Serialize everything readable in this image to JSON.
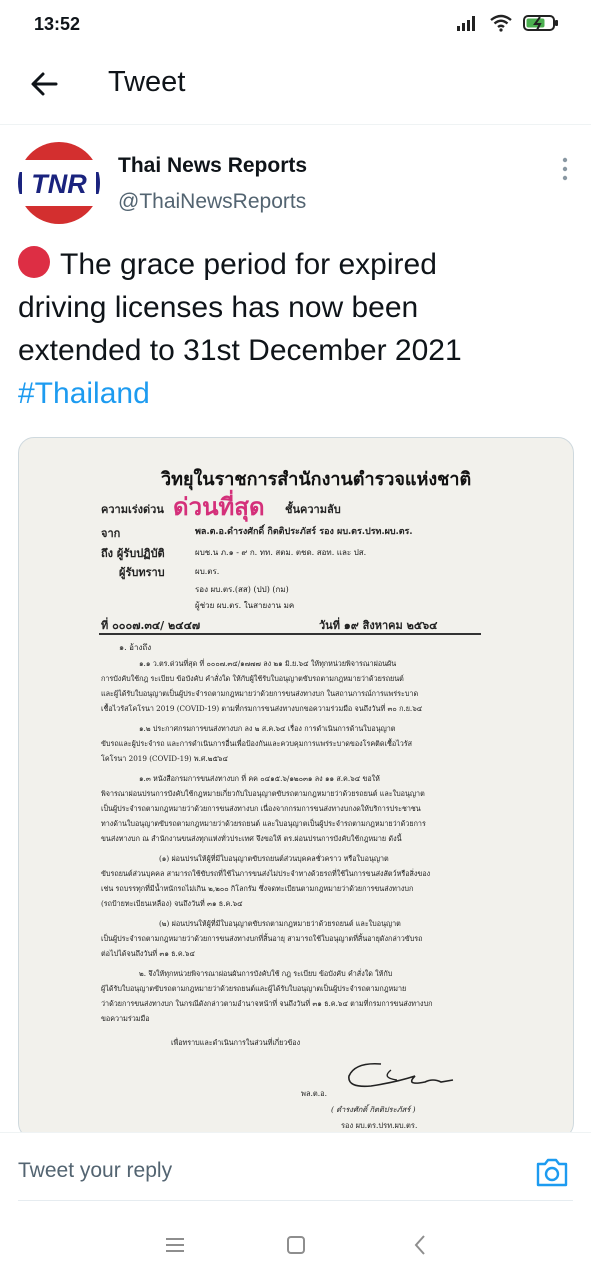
{
  "status": {
    "time": "13:52"
  },
  "appbar": {
    "title": "Tweet"
  },
  "tweet": {
    "author_name": "Thai News Reports",
    "author_handle": "@ThaiNewsReports",
    "avatar_text": "TNR",
    "text_line1": "The grace period for expired",
    "text_line2": "driving licenses has now been",
    "text_line3": "extended to 31st December 2021",
    "hashtag": "#Thailand"
  },
  "document": {
    "heading": "วิทยุในราชการสำนักงานตำรวจแห่งชาติ",
    "urgency_label": "ความเร่งด่วน",
    "urgency_stamp": "ด่วนที่สุด",
    "secrecy_label": "ชั้นความลับ",
    "from_label": "จาก",
    "from_value": "พล.ต.อ.ดำรงศักดิ์ กิตติประภัสร์ รอง ผบ.ตร.ปรท.ผบ.ตร.",
    "to_label": "ถึง ผู้รับปฏิบัติ",
    "to_value": "ผบช.น ภ.๑ - ๙ ก. ทท. สตม. ตชด. สอท. และ ปส.",
    "cc_label": "ผู้รับทราบ",
    "cc_value1": "ผบ.ตร.",
    "cc_value2": "รอง ผบ.ตร.(สส) (ปป) (กม)",
    "cc_value3": "ผู้ช่วย ผบ.ตร. ในสายงาน มค",
    "ref_no": "ที่ ๐๐๐๗.๓๔/ ๒๔๔๗",
    "date_label": "วันที่ ๑๙ สิงหาคม ๒๕๖๔",
    "p_ref": "๑. อ้างถึง",
    "p1_1": "๑.๑ ว.ตร.ด่วนที่สุด ที่ ๐๐๐๗.๓๔/๑๗๗๗ ลง ๒๑ มิ.ย.๖๔ ให้ทุกหน่วยพิจารณาผ่อนผัน",
    "p1_2": "การบังคับใช้กฎ ระเบียบ ข้อบังคับ คำสั่งใด ให้กับผู้ใช้รับใบอนุญาตขับรถตามกฎหมายว่าด้วยรถยนต์",
    "p1_3": "และผู้ได้รับใบอนุญาตเป็นผู้ประจำรถตามกฎหมายว่าด้วยการขนส่งทางบก ในสถานการณ์การแพร่ระบาด",
    "p1_4": "เชื้อไวรัสโคโรนา 2019 (COVID-19) ตามที่กรมการขนส่งทางบกขอความร่วมมือ จนถึงวันที่ ๓๐ ก.ย.๖๔",
    "p2_1": "๑.๒ ประกาศกรมการขนส่งทางบก ลง ๒ ส.ค.๖๔ เรื่อง การดำเนินการด้านใบอนุญาต",
    "p2_2": "ขับรถและผู้ประจำรถ และการดำเนินการอื่นเพื่อป้องกันและควบคุมการแพร่ระบาดของโรคติดเชื้อไวรัส",
    "p2_3": "โคโรนา 2019 (COVID-19) พ.ศ.๒๕๖๔",
    "p3_1": "๑.๓ หนังสือกรมการขนส่งทางบก ที่ คค ๐๔๑๕.๖/๑๒๐๓๑ ลง ๑๑ ส.ค.๖๔ ขอให้",
    "p3_2": "พิจารณาผ่อนปรนการบังคับใช้กฎหมายเกี่ยวกับใบอนุญาตขับรถตามกฎหมายว่าด้วยรถยนต์ และใบอนุญาต",
    "p3_3": "เป็นผู้ประจำรถตามกฎหมายว่าด้วยการขนส่งทางบก เนื่องจากกรมการขนส่งทางบกงดให้บริการประชาชน",
    "p3_4": "ทางด้านใบอนุญาตขับรถตามกฎหมายว่าด้วยรถยนต์ และใบอนุญาตเป็นผู้ประจำรถตามกฎหมายว่าด้วยการ",
    "p3_5": "ขนส่งทางบก ณ สำนักงานขนส่งทุกแห่งทั่วประเทศ จึงขอให้ ตร.ผ่อนปรนการบังคับใช้กฎหมาย ดังนี้",
    "p4_1": "(๑) ผ่อนปรนให้ผู้ที่มีใบอนุญาตขับรถยนต์ส่วนบุคคลชั่วคราว หรือใบอนุญาต",
    "p4_2": "ขับรถยนต์ส่วนบุคคล สามารถใช้ขับรถที่ใช้ในการขนส่งไม่ประจำทางด้วยรถที่ใช้ในการขนส่งสัตว์หรือสิ่งของ",
    "p4_3": "เช่น รถบรรทุกที่มีน้ำหนักรถไม่เกิน ๒,๒๐๐ กิโลกรัม ซึ่งจดทะเบียนตามกฎหมายว่าด้วยการขนส่งทางบก",
    "p4_4": "(รถป้ายทะเบียนเหลือง) จนถึงวันที่ ๓๑ ธ.ค.๖๔",
    "p5_1": "(๒) ผ่อนปรนให้ผู้ที่มีใบอนุญาตขับรถตามกฎหมายว่าด้วยรถยนต์ และใบอนุญาต",
    "p5_2": "เป็นผู้ประจำรถตามกฎหมายว่าด้วยการขนส่งทางบกที่สิ้นอายุ สามารถใช้ใบอนุญาตที่สิ้นอายุดังกล่าวขับรถ",
    "p5_3": "ต่อไปได้จนถึงวันที่ ๓๑ ธ.ค.๖๔",
    "p6_1": "๒. จึงให้ทุกหน่วยพิจารณาผ่อนผันการบังคับใช้ กฎ ระเบียบ ข้อบังคับ คำสั่งใด ให้กับ",
    "p6_2": "ผู้ได้รับใบอนุญาตขับรถตามกฎหมายว่าด้วยรถยนต์และผู้ได้รับใบอนุญาตเป็นผู้ประจำรถตามกฎหมาย",
    "p6_3": "ว่าด้วยการขนส่งทางบก ในกรณีดังกล่าวตามอำนาจหน้าที่ จนถึงวันที่ ๓๑ ธ.ค.๖๔ ตามที่กรมการขนส่งทางบก",
    "p6_4": "ขอความร่วมมือ",
    "closing": "เพื่อทราบและดำเนินการในส่วนที่เกี่ยวข้อง",
    "sign_rank": "พล.ต.อ.",
    "sign_name": "( ดำรงศักดิ์ กิตติประภัสร์ )",
    "sign_title": "รอง ผบ.ตร.ปรท.ผบ.ตร."
  },
  "reply": {
    "placeholder": "Tweet your reply"
  },
  "colors": {
    "accent": "#1d9bf0",
    "red_dot": "#dd2e44",
    "stamp": "#d4307a"
  }
}
